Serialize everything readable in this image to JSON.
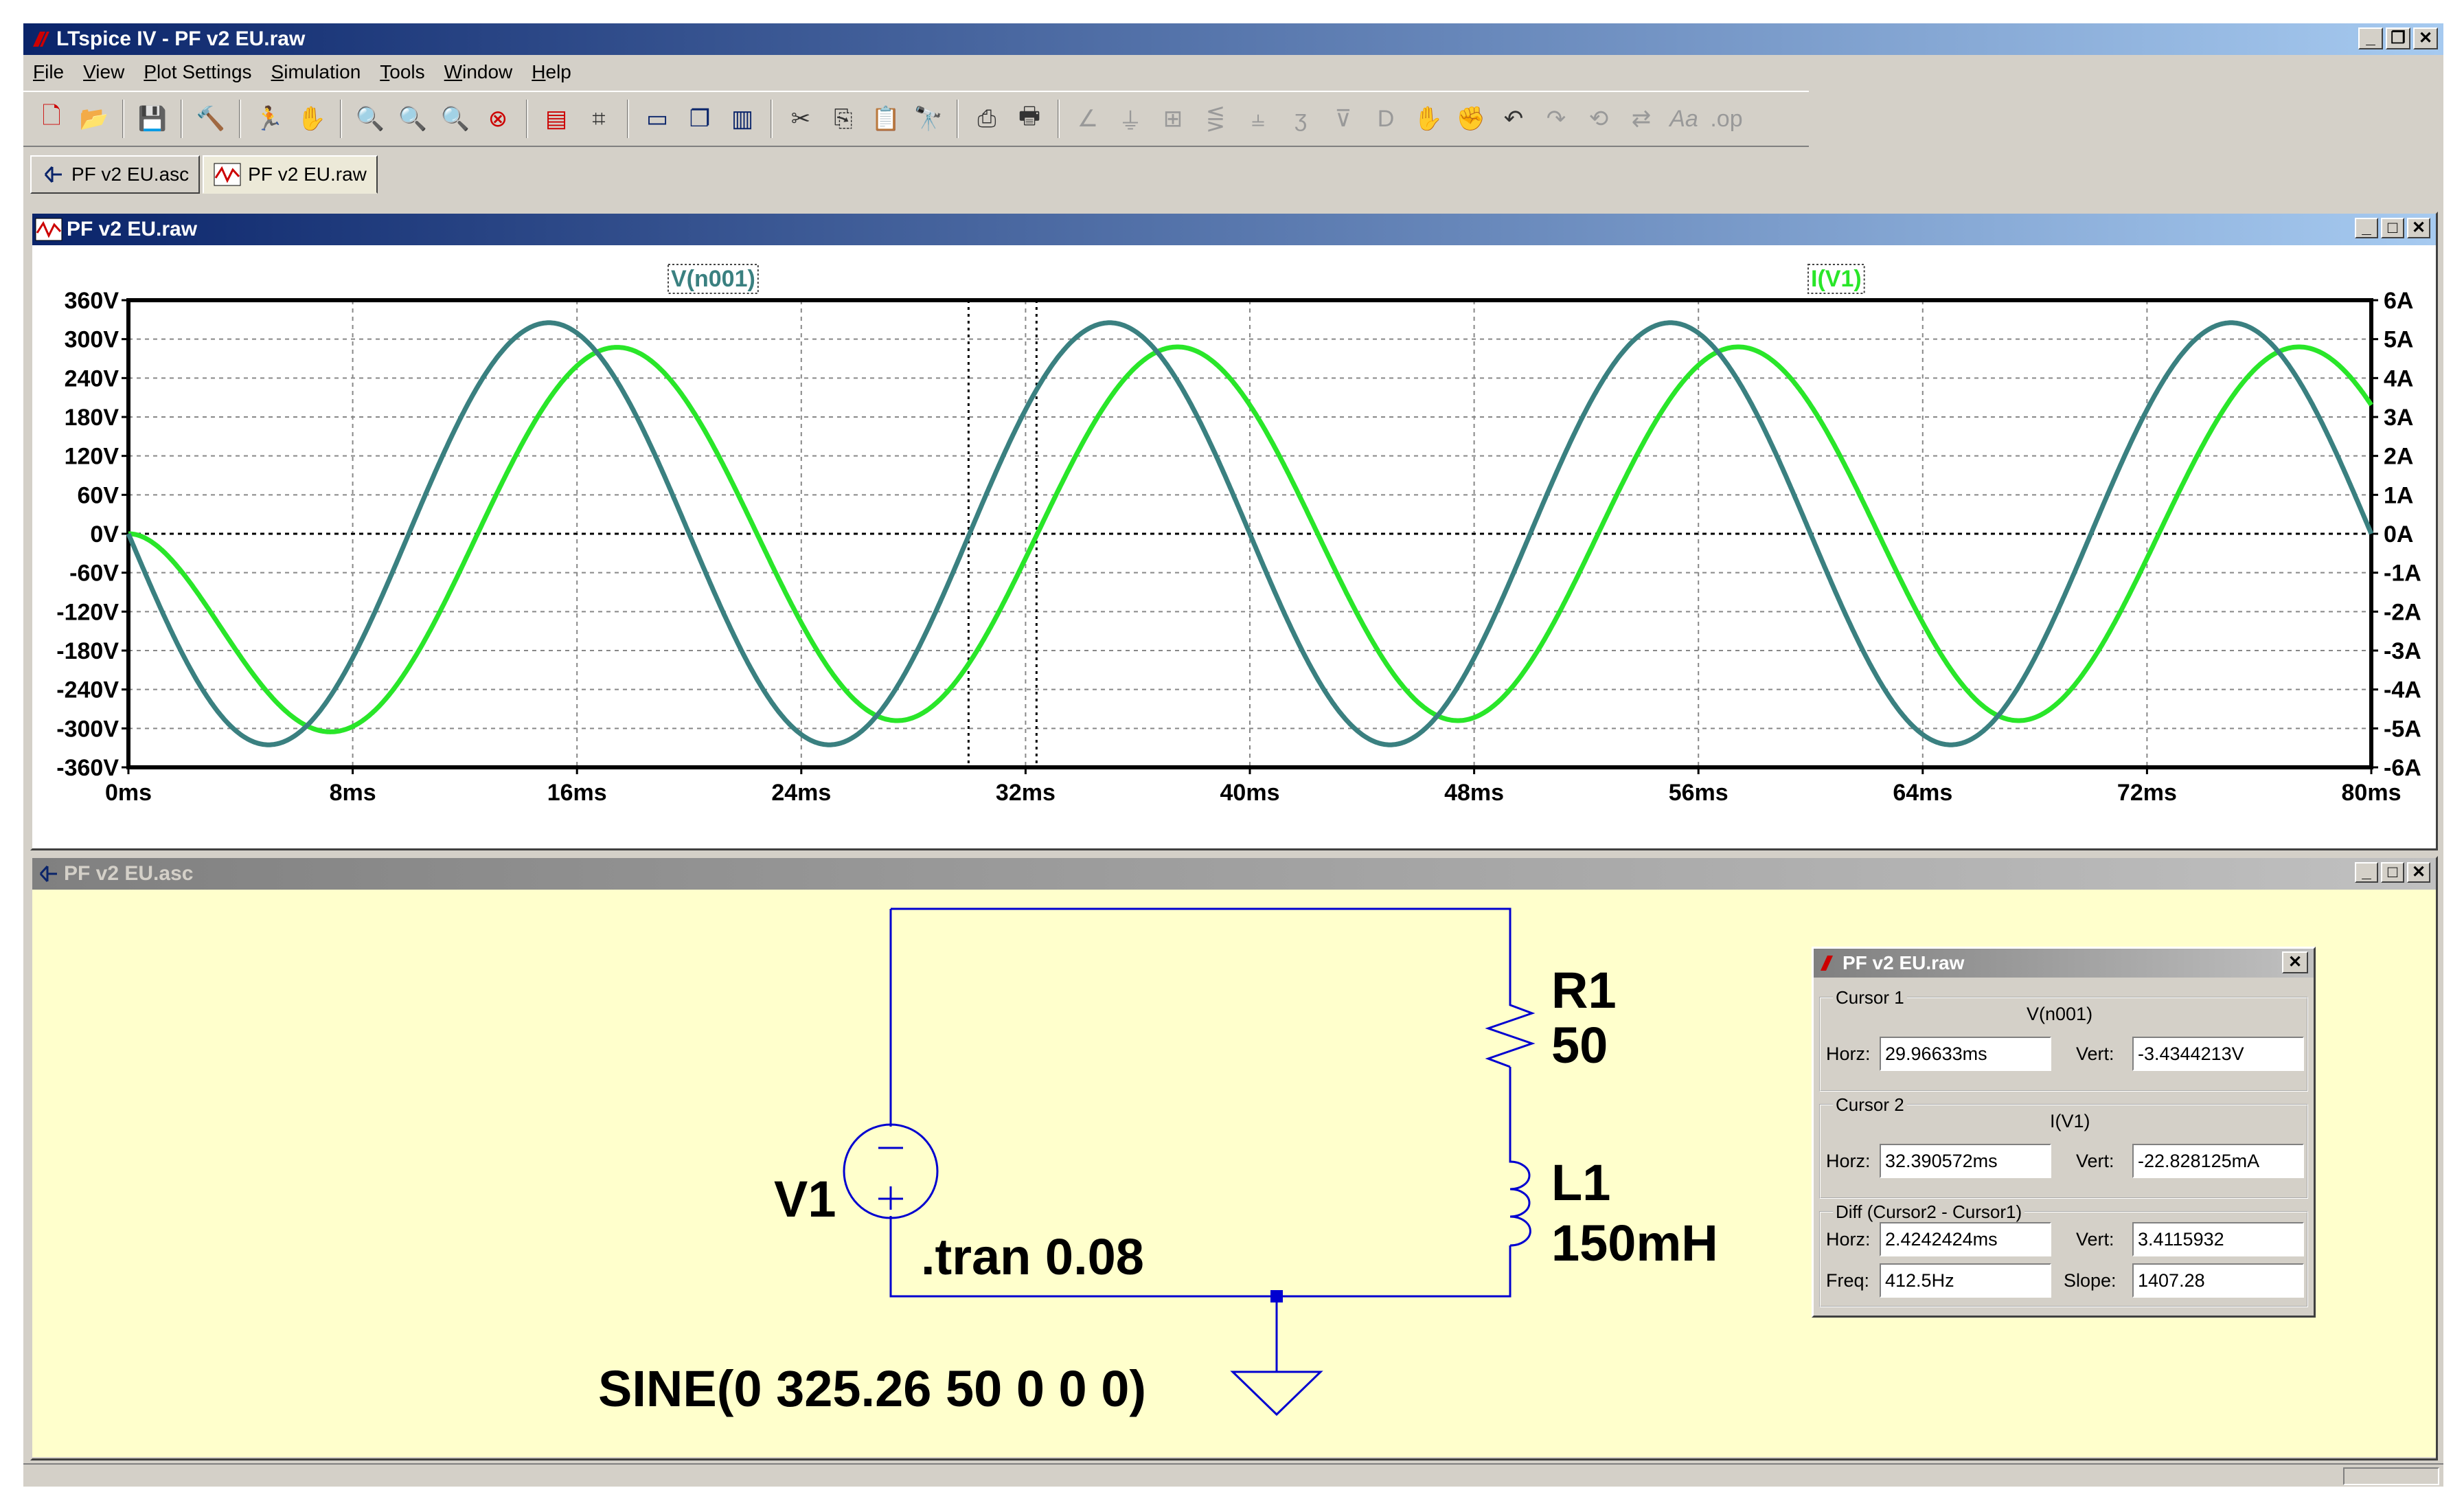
{
  "window": {
    "title": "LTspice IV - PF v2 EU.raw"
  },
  "menu": [
    "File",
    "View",
    "Plot Settings",
    "Simulation",
    "Tools",
    "Window",
    "Help"
  ],
  "toolbar_icons": [
    "new-schematic-icon",
    "open-icon",
    "save-icon",
    "control-panel-icon",
    "run-icon",
    "halt-icon",
    "zoom-area-icon",
    "zoom-in-icon",
    "zoom-out-icon",
    "zoom-cancel-icon",
    "autorange-icon",
    "marker-icon",
    "tile-horizontal-icon",
    "cascade-icon",
    "tile-vertical-icon",
    "cut-icon",
    "copy-icon",
    "paste-icon",
    "find-icon",
    "print-setup-icon",
    "print-icon",
    "wire-icon",
    "ground-icon",
    "label-icon",
    "resistor-icon",
    "capacitor-icon",
    "inductor-icon",
    "diode-icon",
    "component-icon",
    "move-icon",
    "drag-icon",
    "undo-icon",
    "redo-icon",
    "rotate-icon",
    "mirror-icon",
    "text-icon",
    "spice-directive-icon"
  ],
  "tabs": [
    {
      "label": "PF v2 EU.asc"
    },
    {
      "label": "PF v2 EU.raw"
    }
  ],
  "plot": {
    "title": "PF v2 EU.raw",
    "trace1_label": "V(n001)",
    "trace2_label": "I(V1)",
    "colors": {
      "trace1": "#3a8080",
      "trace2": "#29e629",
      "background": "#ffffff"
    },
    "chart_data": {
      "type": "line",
      "x_unit": "ms",
      "x_ticks": [
        "0ms",
        "8ms",
        "16ms",
        "24ms",
        "32ms",
        "40ms",
        "48ms",
        "56ms",
        "64ms",
        "72ms",
        "80ms"
      ],
      "xlim": [
        0,
        80
      ],
      "left_ticks": [
        "360V",
        "300V",
        "240V",
        "180V",
        "120V",
        "60V",
        "0V",
        "-60V",
        "-120V",
        "-180V",
        "-240V",
        "-300V",
        "-360V"
      ],
      "right_ticks": [
        "6A",
        "5A",
        "4A",
        "3A",
        "2A",
        "1A",
        "0A",
        "-1A",
        "-2A",
        "-3A",
        "-4A",
        "-5A",
        "-6A"
      ],
      "ylim_left": [
        -360,
        360
      ],
      "ylim_right": [
        -6,
        6
      ],
      "cursors_ms": [
        29.96633,
        32.390572
      ],
      "series": [
        {
          "name": "V(n001)",
          "axis": "left",
          "amplitude": 325.26,
          "frequency_hz": 50,
          "waveform": "-sin",
          "unit": "V"
        },
        {
          "name": "I(V1)",
          "axis": "right",
          "amplitude": 4.8,
          "frequency_hz": 50,
          "phase_lag_ms": 2.42,
          "unit": "A"
        }
      ],
      "grid": true
    }
  },
  "schematic": {
    "title": "PF v2 EU.asc",
    "source_name": "V1",
    "source_value": "SINE(0 325.26 50 0 0 0)",
    "directive": ".tran 0.08",
    "r_name": "R1",
    "r_value": "50",
    "l_name": "L1",
    "l_value": "150mH",
    "colors": {
      "background": "#ffffcc",
      "wire": "#0000d0"
    }
  },
  "cursor_dialog": {
    "title": "PF v2 EU.raw",
    "cursor1": {
      "label": "Cursor 1",
      "trace": "V(n001)",
      "horz_label": "Horz:",
      "horz": "29.96633ms",
      "vert_label": "Vert:",
      "vert": "-3.4344213V"
    },
    "cursor2": {
      "label": "Cursor 2",
      "trace": "I(V1)",
      "horz_label": "Horz:",
      "horz": "32.390572ms",
      "vert_label": "Vert:",
      "vert": "-22.828125mA"
    },
    "diff": {
      "label": "Diff (Cursor2 - Cursor1)",
      "horz_label": "Horz:",
      "horz": "2.4242424ms",
      "vert_label": "Vert:",
      "vert": "3.4115932",
      "freq_label": "Freq:",
      "freq": "412.5Hz",
      "slope_label": "Slope:",
      "slope": "1407.28"
    }
  }
}
